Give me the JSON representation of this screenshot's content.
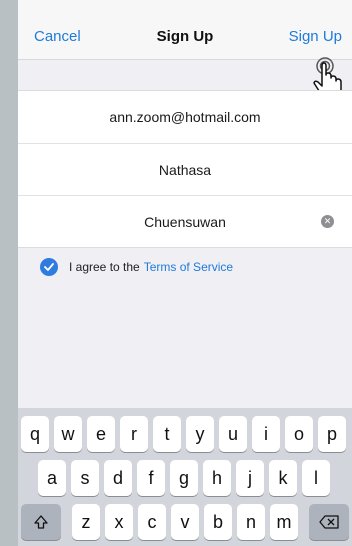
{
  "navbar": {
    "cancel_label": "Cancel",
    "title": "Sign Up",
    "signup_label": "Sign Up"
  },
  "form": {
    "email_value": "ann.zoom@hotmail.com",
    "first_name_value": "Nathasa",
    "last_name_value": "Chuensuwan"
  },
  "agreement": {
    "checked": true,
    "prefix": "I agree to the",
    "link_label": "Terms of Service"
  },
  "keyboard": {
    "row1": [
      "q",
      "w",
      "e",
      "r",
      "t",
      "y",
      "u",
      "i",
      "o",
      "p"
    ],
    "row2": [
      "a",
      "s",
      "d",
      "f",
      "g",
      "h",
      "j",
      "k",
      "l"
    ],
    "row3": [
      "z",
      "x",
      "c",
      "v",
      "b",
      "n",
      "m"
    ],
    "shift_icon": "shift-icon",
    "delete_icon": "backspace-icon"
  },
  "colors": {
    "accent": "#1f7bd8",
    "checkbox": "#2f7ce0",
    "keyboard_bg": "#d2d5db"
  }
}
